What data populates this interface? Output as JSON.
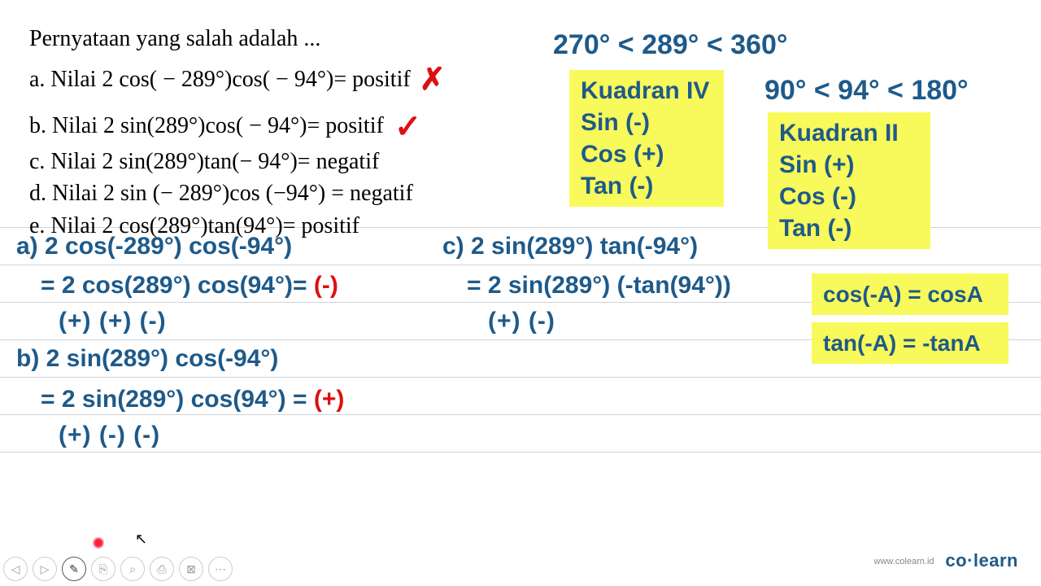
{
  "question": {
    "prompt": "Pernyataan yang salah adalah ...",
    "options": {
      "a": "a. Nilai 2 cos( − 289°)cos( − 94°)= positif",
      "b": "b. Nilai 2 sin(289°)cos( − 94°)= positif",
      "c": "c. Nilai 2 sin(289°)tan(− 94°)= negatif",
      "d": "d. Nilai 2 sin (− 289°)cos (−94°) = negatif",
      "e": "e. Nilai 2 cos(289°)tan(94°)= positif"
    },
    "marks": {
      "a": "✗",
      "b": "✓"
    }
  },
  "ranges": {
    "r289": "270° < 289° < 360°",
    "r94": "90° < 94° < 180°"
  },
  "quadrants": {
    "q4": "Kuadran IV\nSin (-)\nCos (+)\nTan (-)",
    "q2": "Kuadran II\nSin (+)\nCos (-)\nTan (-)"
  },
  "identities": {
    "cos": "cos(-A) = cosA",
    "tan": "tan(-A) = -tanA"
  },
  "work": {
    "a": {
      "l1": "a) 2 cos(-289°) cos(-94°)",
      "l2_pre": "= 2 cos(289°) cos(94°)= ",
      "l2_result": "(-)",
      "l3": "(+)   (+)         (-)"
    },
    "b": {
      "l1": "b) 2 sin(289°) cos(-94°)",
      "l2_pre": "= 2 sin(289°) cos(94°) = ",
      "l2_result": "(+)",
      "l3": "(+)   (-)         (-)"
    },
    "c": {
      "l1": "c) 2 sin(289°) tan(-94°)",
      "l2": "= 2 sin(289°) (-tan(94°))",
      "l3": "(+)   (-)"
    }
  },
  "toolbar": {
    "buttons": [
      "◁",
      "▷",
      "✎",
      "⎘",
      "⌕",
      "⎙",
      "⊠",
      "⋯"
    ]
  },
  "footer": {
    "url": "www.colearn.id",
    "brand": "co·learn"
  }
}
